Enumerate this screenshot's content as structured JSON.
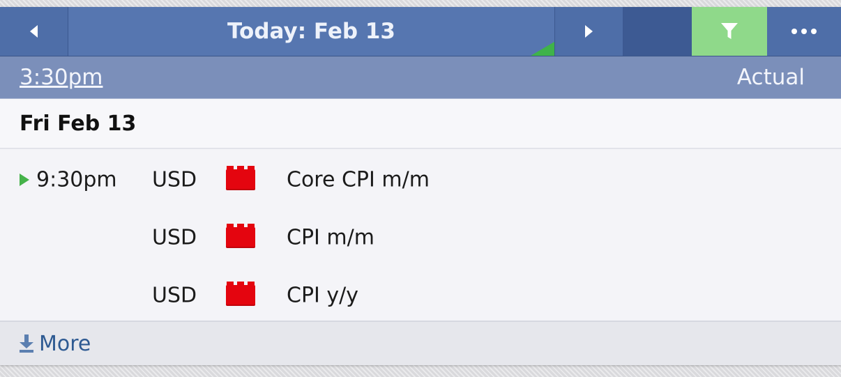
{
  "toolbar": {
    "title": "Today: Feb 13",
    "accent_color": "#8fd98a"
  },
  "subheader": {
    "time": "3:30pm",
    "column_label": "Actual"
  },
  "date_header": "Fri Feb 13",
  "events": [
    {
      "time": "9:30pm",
      "currency": "USD",
      "impact": "high",
      "impact_color": "#e4050f",
      "name": "Core CPI m/m",
      "current": true
    },
    {
      "time": "",
      "currency": "USD",
      "impact": "high",
      "impact_color": "#e4050f",
      "name": "CPI m/m",
      "current": false
    },
    {
      "time": "",
      "currency": "USD",
      "impact": "high",
      "impact_color": "#e4050f",
      "name": "CPI y/y",
      "current": false
    }
  ],
  "footer": {
    "more_label": "More"
  },
  "icons": {
    "prev": "chevron-left-icon",
    "next": "chevron-right-icon",
    "filter": "filter-icon",
    "more": "more-dots-icon",
    "upcoming": "play-icon",
    "impact": "high-impact-icon",
    "download": "download-icon"
  }
}
